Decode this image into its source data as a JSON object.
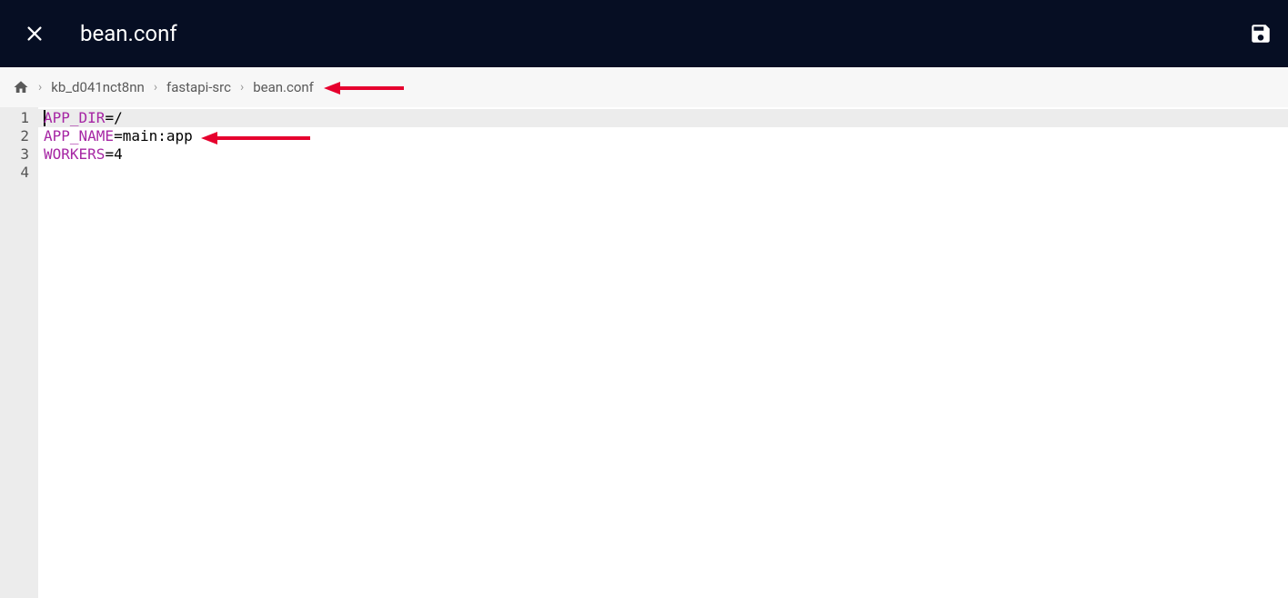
{
  "header": {
    "title": "bean.conf"
  },
  "breadcrumb": {
    "items": [
      "kb_d041nct8nn",
      "fastapi-src",
      "bean.conf"
    ]
  },
  "editor": {
    "lines": [
      {
        "num": "1",
        "key": "APP_DIR",
        "eq": "=",
        "val": "/",
        "active": true
      },
      {
        "num": "2",
        "key": "APP_NAME",
        "eq": "=",
        "val": "main:app",
        "active": false
      },
      {
        "num": "3",
        "key": "WORKERS",
        "eq": "=",
        "val": "4",
        "active": false
      },
      {
        "num": "4",
        "key": "",
        "eq": "",
        "val": "",
        "active": false
      }
    ]
  }
}
